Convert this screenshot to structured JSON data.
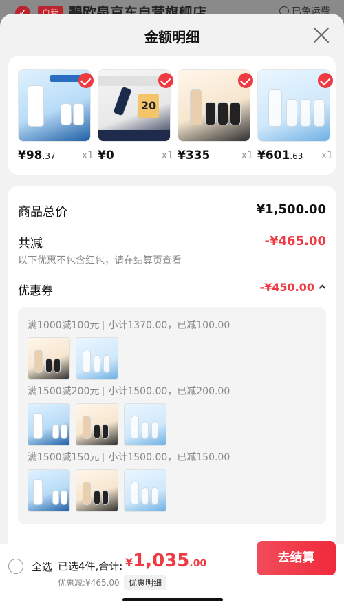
{
  "backdrop": {
    "tag": "自营",
    "store_name": "碧欧泉京东自营旗舰店",
    "right_text": "已免运费"
  },
  "sheet": {
    "title": "金额明细"
  },
  "products": [
    {
      "price_int": "¥98",
      "price_dec": ".37",
      "qty": "x1",
      "thumb": "sunscreen-set"
    },
    {
      "price_int": "¥0",
      "price_dec": "",
      "qty": "x1",
      "thumb": "men-serum"
    },
    {
      "price_int": "¥335",
      "price_dec": "",
      "qty": "x1",
      "thumb": "foundation-set"
    },
    {
      "price_int": "¥601",
      "price_dec": ".63",
      "qty": "x1",
      "thumb": "essence-set"
    }
  ],
  "detail": {
    "total_label": "商品总价",
    "total_value": "¥1,500.00",
    "discount_label": "共减",
    "discount_value": "-¥465.00",
    "note": "以下优惠不包含红包，请在结算页查看",
    "coupon_label": "优惠券",
    "coupon_value": "-¥450.00",
    "coupon_rules": [
      {
        "rule": "满1000减100元",
        "subtotal": "小计1370.00，已减100.00",
        "items": [
          "foundation-set",
          "essence-set"
        ]
      },
      {
        "rule": "满1500减200元",
        "subtotal": "小计1500.00，已减200.00",
        "items": [
          "sunscreen-set",
          "foundation-set",
          "essence-set"
        ]
      },
      {
        "rule": "满1500减150元",
        "subtotal": "小计1500.00，已减150.00",
        "items": [
          "sunscreen-set",
          "foundation-set",
          "essence-set"
        ]
      }
    ]
  },
  "bottom": {
    "select_all": "全选",
    "summary": "已选4件,合计:",
    "total_cur": "¥",
    "total_int": "1,035",
    "total_dec": ".00",
    "discount": "优惠减:¥465.00",
    "detail_link": "优惠明细",
    "checkout": "去结算"
  },
  "colors": {
    "accent": "#ee3a43",
    "sheet_bg": "#f2f2f2"
  }
}
